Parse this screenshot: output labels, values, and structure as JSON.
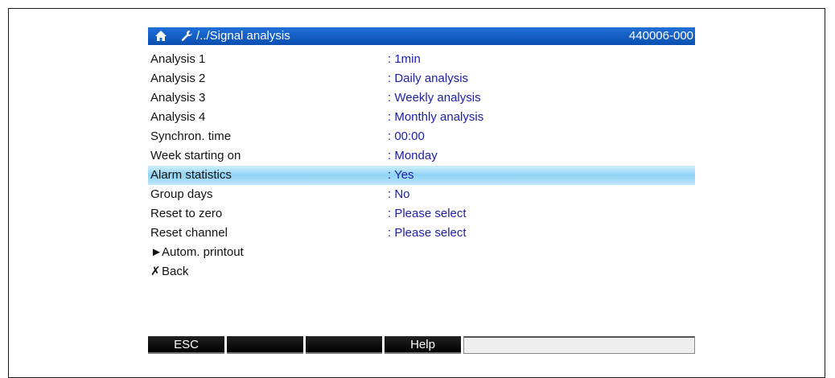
{
  "header": {
    "home_icon": "home-icon",
    "wrench_icon": "wrench-icon",
    "path": "/../Signal analysis",
    "code": "440006-000",
    "accent": "#0b4fb0"
  },
  "rows": [
    {
      "label": "Analysis 1",
      "value": ": 1min"
    },
    {
      "label": "Analysis 2",
      "value": ": Daily analysis"
    },
    {
      "label": "Analysis 3",
      "value": ": Weekly analysis"
    },
    {
      "label": "Analysis 4",
      "value": ": Monthly analysis"
    },
    {
      "label": "Synchron. time",
      "value": ": 00:00"
    },
    {
      "label": "Week starting on",
      "value": ": Monday"
    },
    {
      "label": "Alarm statistics",
      "value": ": Yes",
      "selected": true
    },
    {
      "label": "Group days",
      "value": ": No"
    },
    {
      "label": "Reset to zero",
      "value": ": Please select"
    },
    {
      "label": "Reset channel",
      "value": ": Please select"
    }
  ],
  "submenu": {
    "glyph": "►",
    "label": "Autom. printout"
  },
  "back": {
    "glyph": "✗",
    "label": "Back"
  },
  "footer": {
    "keys": [
      "ESC",
      "",
      "",
      "Help"
    ]
  }
}
